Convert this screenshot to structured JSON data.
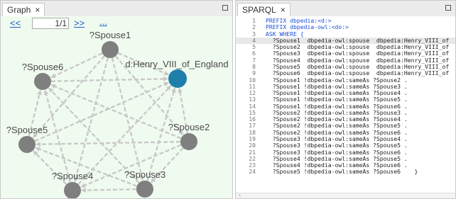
{
  "graph_tab": {
    "label": "Graph",
    "close": "×"
  },
  "sparql_tab": {
    "label": "SPARQL",
    "close": "×"
  },
  "pager": {
    "first": "<<",
    "page": "1/1",
    "next": ">>",
    "more": "..."
  },
  "colors": {
    "node": "#7f7f7f",
    "highlight": "#1f7fab",
    "edge": "#c9c9c9",
    "link": "#1a5fcc",
    "graph_bg": "#f0fbef",
    "keyword": "#1b4fd8"
  },
  "nodes": [
    {
      "id": "spouse1",
      "label": "?Spouse1"
    },
    {
      "id": "henry",
      "label": "d:Henry_VIII_of_England"
    },
    {
      "id": "spouse2",
      "label": "?Spouse2"
    },
    {
      "id": "spouse3",
      "label": "?Spouse3"
    },
    {
      "id": "spouse4",
      "label": "?Spouse4"
    },
    {
      "id": "spouse5",
      "label": "?Spouse5"
    },
    {
      "id": "spouse6",
      "label": "?Spouse6"
    }
  ],
  "code_lines": [
    {
      "n": "1",
      "text": "PREFIX dbpedia:<d:>",
      "kw": true
    },
    {
      "n": "2",
      "text": "PREFIX dbpedia-owl:<do:>",
      "kw": true
    },
    {
      "n": "3",
      "text": "ASK WHERE {",
      "kw": true
    },
    {
      "n": "4",
      "text": "  ?Spouse1  dbpedia-owl:spouse  dbpedia:Henry_VIII_of",
      "hl": true
    },
    {
      "n": "5",
      "text": "  ?Spouse2  dbpedia-owl:spouse  dbpedia:Henry_VIII_of"
    },
    {
      "n": "6",
      "text": "  ?Spouse3  dbpedia-owl:spouse  dbpedia:Henry_VIII_of"
    },
    {
      "n": "7",
      "text": "  ?Spouse4  dbpedia-owl:spouse  dbpedia:Henry_VIII_of"
    },
    {
      "n": "8",
      "text": "  ?Spouse5  dbpedia-owl:spouse  dbpedia:Henry_VIII_of"
    },
    {
      "n": "9",
      "text": "  ?Spouse6  dbpedia-owl:spouse  dbpedia:Henry_VIII_of"
    },
    {
      "n": "10",
      "text": "  ?Spouse1 !dbpedia-owl:sameAs ?Spouse2 ."
    },
    {
      "n": "11",
      "text": "  ?Spouse1 !dbpedia-owl:sameAs ?Spouse3 ."
    },
    {
      "n": "12",
      "text": "  ?Spouse1 !dbpedia-owl:sameAs ?Spouse4 ."
    },
    {
      "n": "13",
      "text": "  ?Spouse1 !dbpedia-owl:sameAs ?Spouse5 ."
    },
    {
      "n": "14",
      "text": "  ?Spouse1 !dbpedia-owl:sameAs ?Spouse6 ."
    },
    {
      "n": "15",
      "text": "  ?Spouse2 !dbpedia-owl:sameAs ?Spouse3 ."
    },
    {
      "n": "16",
      "text": "  ?Spouse2 !dbpedia-owl:sameAs ?Spouse4 ."
    },
    {
      "n": "17",
      "text": "  ?Spouse2 !dbpedia-owl:sameAs ?Spouse5 ."
    },
    {
      "n": "18",
      "text": "  ?Spouse2 !dbpedia-owl:sameAs ?Spouse6 ."
    },
    {
      "n": "19",
      "text": "  ?Spouse3 !dbpedia-owl:sameAs ?Spouse4 ."
    },
    {
      "n": "20",
      "text": "  ?Spouse3 !dbpedia-owl:sameAs ?Spouse5 ."
    },
    {
      "n": "21",
      "text": "  ?Spouse3 !dbpedia-owl:sameAs ?Spouse6 ."
    },
    {
      "n": "22",
      "text": "  ?Spouse4 !dbpedia-owl:sameAs ?Spouse5 ."
    },
    {
      "n": "23",
      "text": "  ?Spouse4 !dbpedia-owl:sameAs ?Spouse6 ."
    },
    {
      "n": "24",
      "text": "  ?Spouse5 !dbpedia-owl:sameAs ?Spouse6    }"
    }
  ]
}
